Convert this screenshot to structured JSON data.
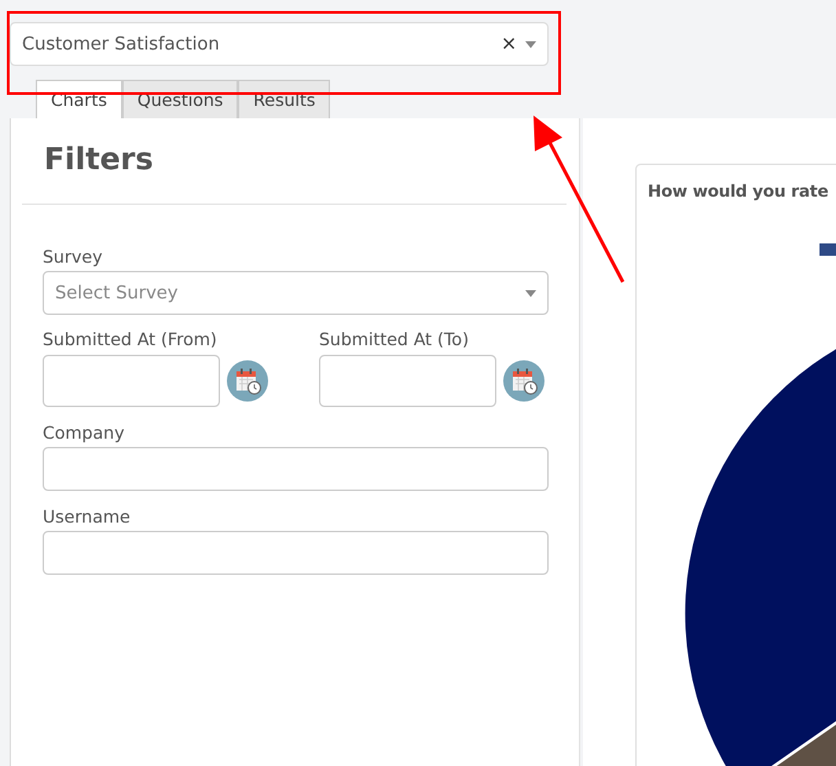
{
  "survey_combo": {
    "value": "Customer Satisfaction",
    "clear_symbol": "×"
  },
  "tabs": [
    {
      "label": "Charts",
      "selected": true
    },
    {
      "label": "Questions",
      "selected": false
    },
    {
      "label": "Results",
      "selected": false
    }
  ],
  "filters": {
    "title": "Filters",
    "fields": [
      {
        "kind": "select",
        "label": "Survey",
        "placeholder": "Select Survey"
      },
      {
        "kind": "date-pair",
        "items": [
          {
            "label": "Submitted At (From)"
          },
          {
            "label": "Submitted At (To)"
          }
        ]
      },
      {
        "kind": "text",
        "label": "Company"
      },
      {
        "kind": "text",
        "label": "Username"
      }
    ]
  },
  "chart_card": {
    "title": "How would you rate"
  }
}
